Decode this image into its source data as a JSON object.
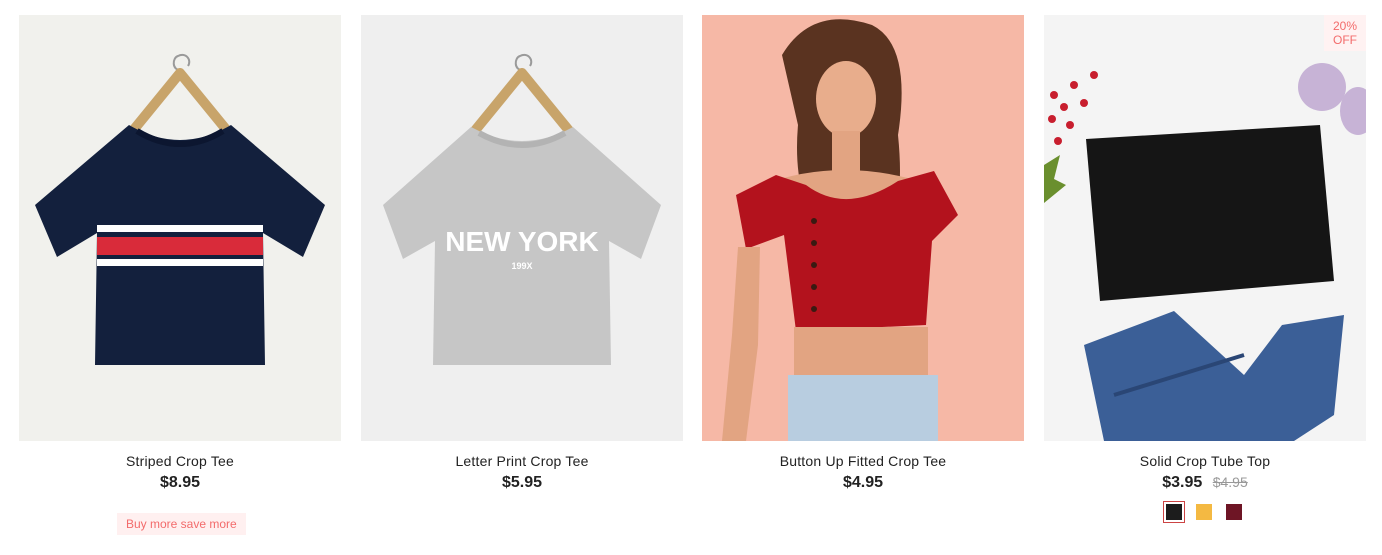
{
  "products": [
    {
      "name": "Striped Crop Tee",
      "price": "$8.95",
      "promo": "Buy more save more"
    },
    {
      "name": "Letter Print Crop Tee",
      "price": "$5.95",
      "print_text": "NEW YORK",
      "print_subtext": "199X"
    },
    {
      "name": "Button Up Fitted Crop Tee",
      "price": "$4.95"
    },
    {
      "name": "Solid Crop Tube Top",
      "price": "$3.95",
      "original_price": "$4.95",
      "badge_line1": "20%",
      "badge_line2": "OFF",
      "swatches": [
        {
          "color": "#1c1c1c",
          "name": "black",
          "selected": true
        },
        {
          "color": "#f4b942",
          "name": "yellow",
          "selected": false
        },
        {
          "color": "#6e1525",
          "name": "burgundy",
          "selected": false
        }
      ]
    }
  ],
  "colors": {
    "accent": "#f36b6b",
    "promo_bg": "#fff0f0"
  }
}
